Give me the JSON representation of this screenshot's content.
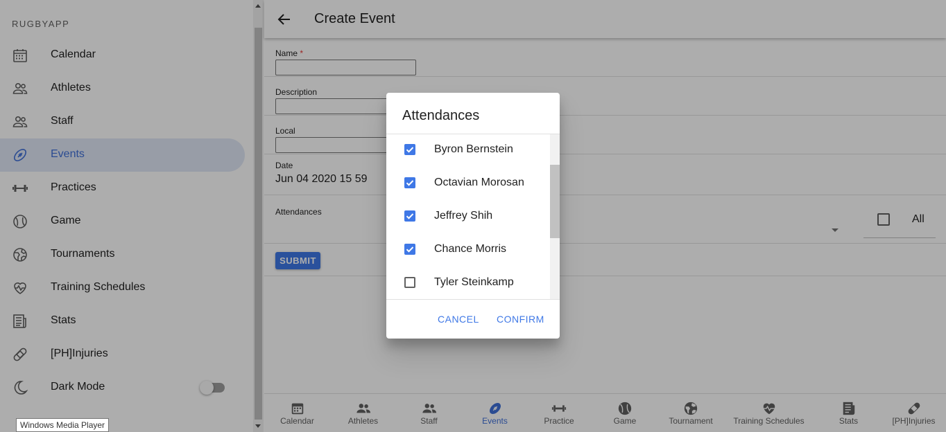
{
  "sidebar": {
    "app_name": "RUGBYAPP",
    "items": [
      {
        "label": "Calendar",
        "icon": "calendar-icon"
      },
      {
        "label": "Athletes",
        "icon": "people-icon"
      },
      {
        "label": "Staff",
        "icon": "people-icon"
      },
      {
        "label": "Events",
        "icon": "football-icon"
      },
      {
        "label": "Practices",
        "icon": "dumbbell-icon"
      },
      {
        "label": "Game",
        "icon": "ball-icon"
      },
      {
        "label": "Tournaments",
        "icon": "globe-icon"
      },
      {
        "label": "Training Schedules",
        "icon": "heart-pulse-icon"
      },
      {
        "label": "Stats",
        "icon": "newspaper-icon"
      },
      {
        "label": "[PH]Injuries",
        "icon": "bandage-icon"
      },
      {
        "label": "Dark Mode",
        "icon": "moon-icon"
      }
    ],
    "active_item": "Events",
    "dark_mode_enabled": false
  },
  "appbar": {
    "title": "Create Event"
  },
  "form": {
    "name_label": "Name",
    "name_required_mark": "*",
    "name_value": "",
    "description_label": "Description",
    "description_value": "",
    "local_label": "Local",
    "local_value": "",
    "date_label": "Date",
    "date_value": "Jun 04 2020 15 59",
    "attendances_label": "Attendances",
    "all_label": "All",
    "submit_label": "SUBMIT"
  },
  "dialog": {
    "title": "Attendances",
    "attendees": [
      {
        "name": "Byron Bernstein",
        "checked": true
      },
      {
        "name": "Octavian Morosan",
        "checked": true
      },
      {
        "name": "Jeffrey Shih",
        "checked": true
      },
      {
        "name": "Chance Morris",
        "checked": true
      },
      {
        "name": "Tyler Steinkamp",
        "checked": false
      }
    ],
    "cancel_label": "CANCEL",
    "confirm_label": "CONFIRM"
  },
  "bottom_nav": {
    "items": [
      {
        "label": "Calendar",
        "icon": "calendar-icon"
      },
      {
        "label": "Athletes",
        "icon": "people-icon"
      },
      {
        "label": "Staff",
        "icon": "people-icon"
      },
      {
        "label": "Events",
        "icon": "football-icon"
      },
      {
        "label": "Practice",
        "icon": "dumbbell-icon"
      },
      {
        "label": "Game",
        "icon": "ball-icon"
      },
      {
        "label": "Tournament",
        "icon": "globe-icon"
      },
      {
        "label": "Training Schedules",
        "icon": "heart-pulse-icon"
      },
      {
        "label": "Stats",
        "icon": "newspaper-icon"
      },
      {
        "label": "[PH]Injuries",
        "icon": "bandage-icon"
      }
    ],
    "active_item": "Events"
  },
  "tooltip": {
    "text": "Windows Media Player"
  },
  "colors": {
    "accent": "#3f78e6",
    "active_bg": "#e1e8f7"
  }
}
